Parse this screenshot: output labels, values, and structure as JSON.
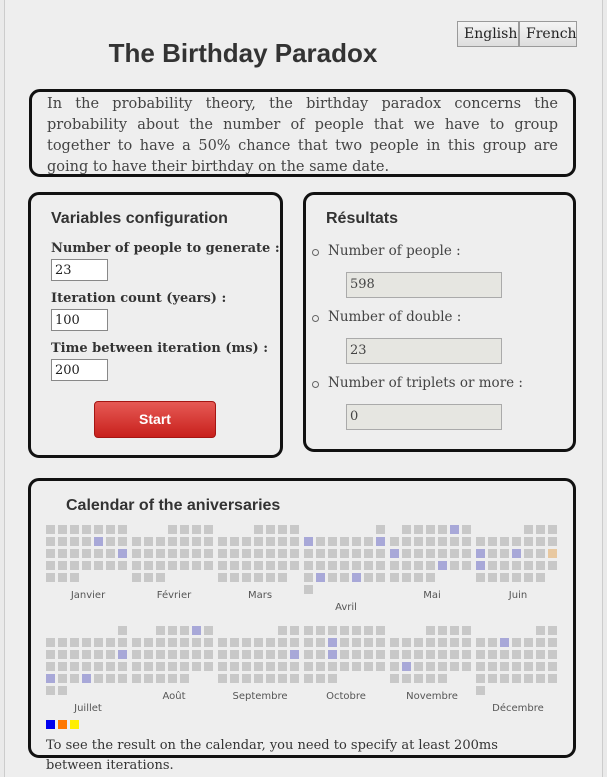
{
  "languages": [
    "English",
    "French"
  ],
  "title": "The Birthday Paradox",
  "intro": "In the probability theory, the birthday paradox concerns the probability about the number of people that we have to group together to have a 50% chance that two people in this group are going to have their birthday on the same date.",
  "config": {
    "heading": "Variables configuration",
    "people_label": "Number of people to generate :",
    "people_value": "23",
    "iterations_label": "Iteration count (years) :",
    "iterations_value": "100",
    "delay_label": "Time between iteration (ms) :",
    "delay_value": "200",
    "start_label": "Start"
  },
  "results": {
    "heading": "Résultats",
    "people_label": "Number of people :",
    "people_value": "598",
    "double_label": "Number of double :",
    "double_value": "23",
    "triplets_label": "Number of triplets or more :",
    "triplets_value": "0"
  },
  "calendar": {
    "heading": "Calendar of the aniversaries",
    "months": [
      {
        "name": "Janvier",
        "first_weekday": 0,
        "days": 31,
        "blue": [
          12,
          21
        ],
        "orange": []
      },
      {
        "name": "Février",
        "first_weekday": 3,
        "days": 28,
        "blue": [],
        "orange": []
      },
      {
        "name": "Mars",
        "first_weekday": 3,
        "days": 31,
        "blue": [],
        "orange": []
      },
      {
        "name": "Avril",
        "first_weekday": 6,
        "days": 30,
        "blue": [
          2,
          8,
          24,
          27
        ],
        "orange": []
      },
      {
        "name": "Mai",
        "first_weekday": 1,
        "days": 31,
        "blue": [
          5,
          14,
          25
        ],
        "orange": []
      },
      {
        "name": "Juin",
        "first_weekday": 4,
        "days": 30,
        "blue": [
          11,
          14,
          18
        ],
        "orange": [
          17
        ]
      },
      {
        "name": "Juillet",
        "first_weekday": 6,
        "days": 31,
        "blue": [
          15,
          23,
          26
        ],
        "orange": []
      },
      {
        "name": "Août",
        "first_weekday": 2,
        "days": 31,
        "blue": [
          4
        ],
        "orange": []
      },
      {
        "name": "Septembre",
        "first_weekday": 5,
        "days": 30,
        "blue": [
          16
        ],
        "orange": []
      },
      {
        "name": "Octobre",
        "first_weekday": 0,
        "days": 31,
        "blue": [
          10,
          17
        ],
        "orange": []
      },
      {
        "name": "Novembre",
        "first_weekday": 3,
        "days": 30,
        "blue": [
          20
        ],
        "orange": []
      },
      {
        "name": "Décembre",
        "first_weekday": 5,
        "days": 31,
        "blue": [
          5
        ],
        "orange": []
      }
    ],
    "legend_colors": [
      "#0000ee",
      "#ff7700",
      "#ffee00"
    ],
    "cell_color": "#c8c8c8",
    "double_color": "#a8a8d8",
    "triple_color": "#e8c8a0"
  },
  "note": "To see the result on the calendar, you need to specify at least 200ms between iterations."
}
